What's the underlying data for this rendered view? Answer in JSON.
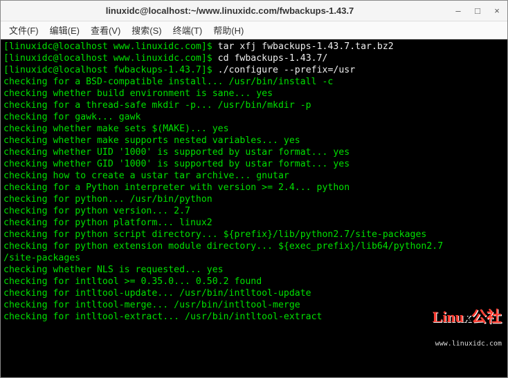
{
  "window": {
    "title": "linuxidc@localhost:~/www.linuxidc.com/fwbackups-1.43.7",
    "controls": {
      "min": "–",
      "max": "□",
      "close": "×"
    }
  },
  "menu": {
    "file": "文件(F)",
    "edit": "编辑(E)",
    "view": "查看(V)",
    "search": "搜索(S)",
    "terminal": "终端(T)",
    "help": "帮助(H)"
  },
  "prompts": {
    "p1a": "[linuxidc@localhost www.linuxidc.com]$ ",
    "p1b": "tar xfj fwbackups-1.43.7.tar.bz2",
    "p2a": "[linuxidc@localhost www.linuxidc.com]$ ",
    "p2b": "cd fwbackups-1.43.7/",
    "p3a": "[linuxidc@localhost fwbackups-1.43.7]$ ",
    "p3b": "./configure --prefix=/usr"
  },
  "output": {
    "l01": "checking for a BSD-compatible install... /usr/bin/install -c",
    "l02": "checking whether build environment is sane... yes",
    "l03": "checking for a thread-safe mkdir -p... /usr/bin/mkdir -p",
    "l04": "checking for gawk... gawk",
    "l05": "checking whether make sets $(MAKE)... yes",
    "l06": "checking whether make supports nested variables... yes",
    "l07": "checking whether UID '1000' is supported by ustar format... yes",
    "l08": "checking whether GID '1000' is supported by ustar format... yes",
    "l09": "checking how to create a ustar tar archive... gnutar",
    "l10": "checking for a Python interpreter with version >= 2.4... python",
    "l11": "checking for python... /usr/bin/python",
    "l12": "checking for python version... 2.7",
    "l13": "checking for python platform... linux2",
    "l14": "checking for python script directory... ${prefix}/lib/python2.7/site-packages",
    "l15": "checking for python extension module directory... ${exec_prefix}/lib64/python2.7",
    "l16": "/site-packages",
    "l17": "checking whether NLS is requested... yes",
    "l18": "checking for intltool >= 0.35.0... 0.50.2 found",
    "l19": "checking for intltool-update... /usr/bin/intltool-update",
    "l20": "checking for intltool-merge... /usr/bin/intltool-merge",
    "l21": "checking for intltool-extract... /usr/bin/intltool-extract"
  },
  "brand": {
    "name_pre": "Linu",
    "name_post": "公社",
    "url": "www.linuxidc.com"
  }
}
